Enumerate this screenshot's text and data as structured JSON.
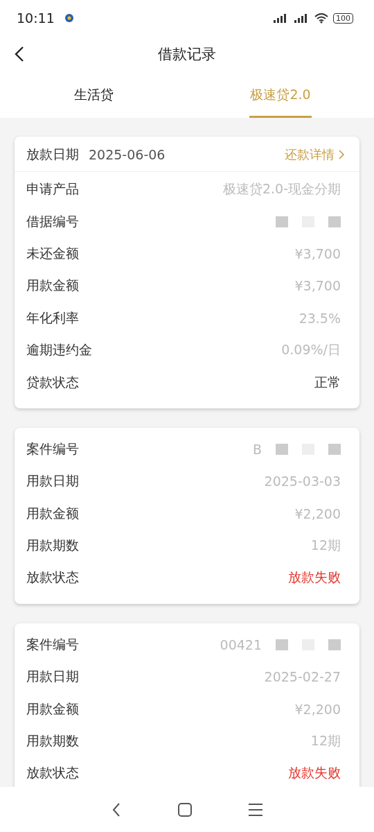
{
  "status_bar": {
    "time": "10:11",
    "battery": "100"
  },
  "header": {
    "title": "借款记录"
  },
  "tabs": [
    {
      "label": "生活贷",
      "selected": false
    },
    {
      "label": "极速贷2.0",
      "selected": true
    }
  ],
  "cards": [
    {
      "head": {
        "label": "放款日期",
        "date": "2025-06-06",
        "link": "还款详情"
      },
      "rows": [
        {
          "label": "申请产品",
          "value": "极速贷2.0-现金分期",
          "color": "#bbbbbb"
        },
        {
          "label": "借据编号",
          "redacted": true
        },
        {
          "label": "未还金额",
          "value": "¥3,700",
          "color": "#bbbbbb"
        },
        {
          "label": "用款金额",
          "value": "¥3,700",
          "color": "#bbbbbb"
        },
        {
          "label": "年化利率",
          "value": "23.5%",
          "color": "#bbbbbb"
        },
        {
          "label": "逾期违约金",
          "value": "0.09%/日",
          "color": "#bbbbbb"
        },
        {
          "label": "贷款状态",
          "value": "正常",
          "color": "#333333"
        }
      ]
    },
    {
      "rows": [
        {
          "label": "案件编号",
          "value": "B",
          "redacted": true,
          "color": "#bbbbbb"
        },
        {
          "label": "用款日期",
          "value": "2025-03-03",
          "color": "#bbbbbb"
        },
        {
          "label": "用款金额",
          "value": "¥2,200",
          "color": "#bbbbbb"
        },
        {
          "label": "用款期数",
          "value": "12期",
          "color": "#bbbbbb"
        },
        {
          "label": "放款状态",
          "value": "放款失败",
          "color": "#e5352b"
        }
      ]
    },
    {
      "rows": [
        {
          "label": "案件编号",
          "value": "00421",
          "redacted": true,
          "color": "#bbbbbb"
        },
        {
          "label": "用款日期",
          "value": "2025-02-27",
          "color": "#bbbbbb"
        },
        {
          "label": "用款金额",
          "value": "¥2,200",
          "color": "#bbbbbb"
        },
        {
          "label": "用款期数",
          "value": "12期",
          "color": "#bbbbbb"
        },
        {
          "label": "放款状态",
          "value": "放款失败",
          "color": "#e5352b"
        }
      ]
    }
  ]
}
